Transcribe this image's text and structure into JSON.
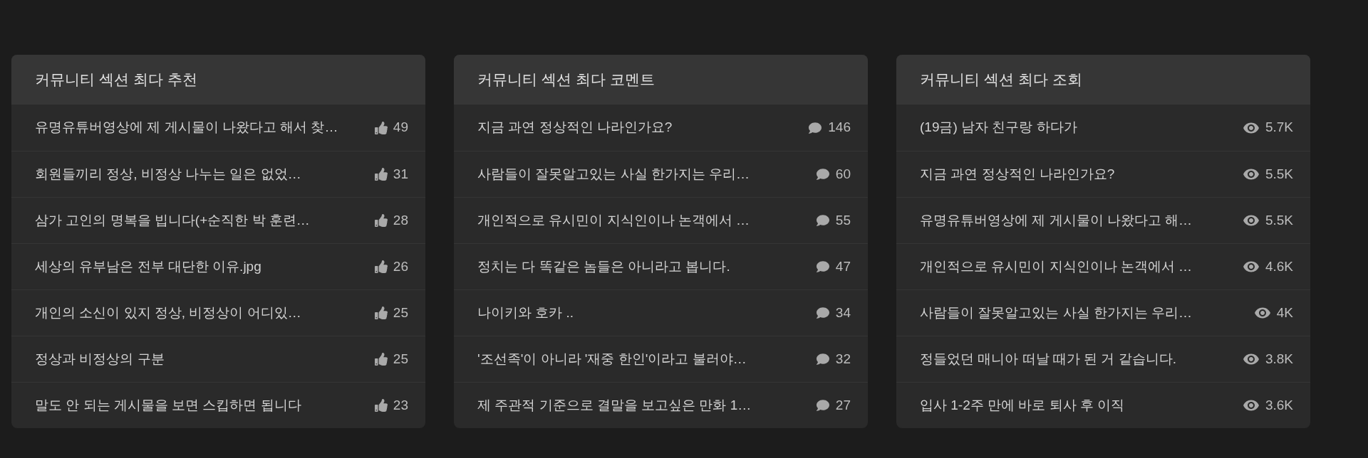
{
  "panels": [
    {
      "title": "커뮤니티 섹션 최다 추천",
      "kind": "likes",
      "items": [
        {
          "title": "유명유튜버영상에 제 게시물이 나왔다고 해서 찾…",
          "count": "49"
        },
        {
          "title": "회원들끼리 정상, 비정상 나누는 일은 없었…",
          "count": "31"
        },
        {
          "title": "삼가 고인의 명복을 빕니다(+순직한 박 훈련…",
          "count": "28"
        },
        {
          "title": "세상의 유부남은 전부 대단한 이유.jpg",
          "count": "26"
        },
        {
          "title": "개인의 소신이 있지 정상, 비정상이 어디있…",
          "count": "25"
        },
        {
          "title": "정상과 비정상의 구분",
          "count": "25"
        },
        {
          "title": "말도 안 되는 게시물을 보면 스킵하면 됩니다",
          "count": "23"
        }
      ]
    },
    {
      "title": "커뮤니티 섹션 최다 코멘트",
      "kind": "comments",
      "items": [
        {
          "title": "지금 과연 정상적인 나라인가요?",
          "count": "146"
        },
        {
          "title": "사람들이 잘못알고있는 사실 한가지는 우리…",
          "count": "60"
        },
        {
          "title": "개인적으로 유시민이 지식인이나 논객에서 …",
          "count": "55"
        },
        {
          "title": "정치는 다 똑같은 놈들은 아니라고 봅니다.",
          "count": "47"
        },
        {
          "title": "나이키와 호카 ..",
          "count": "34"
        },
        {
          "title": "'조선족'이 아니라 '재중 한인'이라고 불러야…",
          "count": "32"
        },
        {
          "title": "제 주관적 기준으로 결말을 보고싶은 만화 1…",
          "count": "27"
        }
      ]
    },
    {
      "title": "커뮤니티 섹션 최다 조회",
      "kind": "views",
      "items": [
        {
          "title": "(19금) 남자 친구랑 하다가",
          "count": "5.7K"
        },
        {
          "title": "지금 과연 정상적인 나라인가요?",
          "count": "5.5K"
        },
        {
          "title": "유명유튜버영상에 제 게시물이 나왔다고 해…",
          "count": "5.5K"
        },
        {
          "title": "개인적으로 유시민이 지식인이나 논객에서 …",
          "count": "4.6K"
        },
        {
          "title": "사람들이 잘못알고있는 사실 한가지는 우리…",
          "count": "4K"
        },
        {
          "title": "정들었던 매니아 떠날 때가 된 거 같습니다.",
          "count": "3.8K"
        },
        {
          "title": "입사 1-2주 만에 바로 퇴사 후 이직",
          "count": "3.6K"
        }
      ]
    }
  ]
}
